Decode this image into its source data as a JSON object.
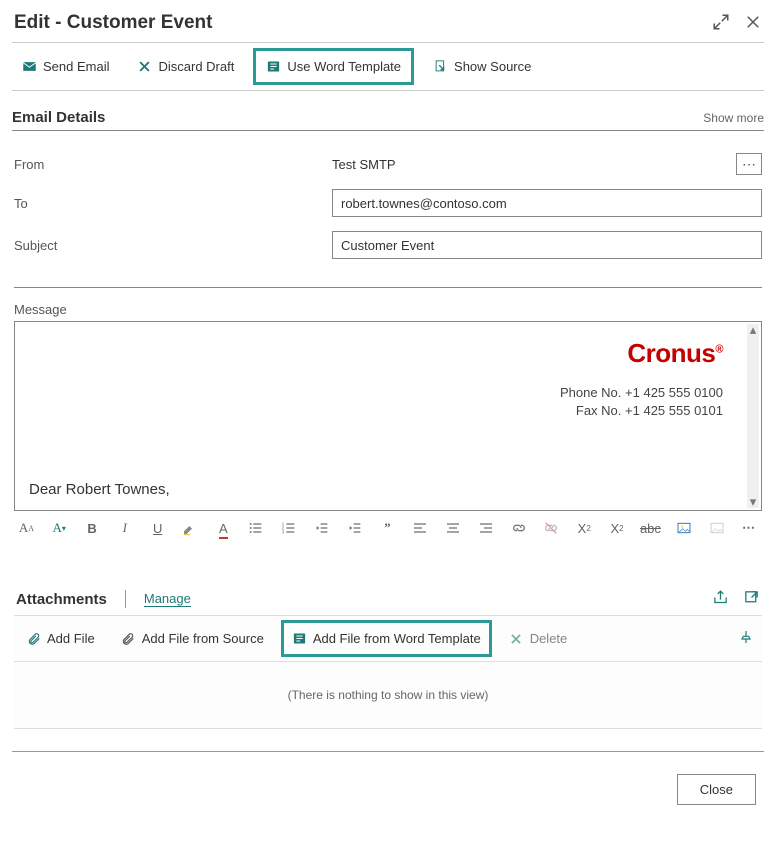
{
  "dialog": {
    "title": "Edit - Customer Event"
  },
  "toolbar": {
    "send_email": "Send Email",
    "discard_draft": "Discard Draft",
    "use_word_template": "Use Word Template",
    "show_source": "Show Source"
  },
  "details": {
    "section_title": "Email Details",
    "show_more": "Show more",
    "from_label": "From",
    "from_value": "Test SMTP",
    "to_label": "To",
    "to_value": "robert.townes@contoso.com",
    "subject_label": "Subject",
    "subject_value": "Customer Event"
  },
  "message": {
    "label": "Message",
    "brand": "Cronus",
    "phone_label": "Phone No.",
    "phone": "+1 425 555 0100",
    "fax_label": "Fax No.",
    "fax": "+1 425 555 0101",
    "greeting": "Dear Robert Townes,"
  },
  "attachments": {
    "title": "Attachments",
    "manage": "Manage",
    "add_file": "Add File",
    "add_file_from_source": "Add File from Source",
    "add_file_from_word_template": "Add File from Word Template",
    "delete": "Delete",
    "empty": "(There is nothing to show in this view)"
  },
  "footer": {
    "close": "Close"
  }
}
